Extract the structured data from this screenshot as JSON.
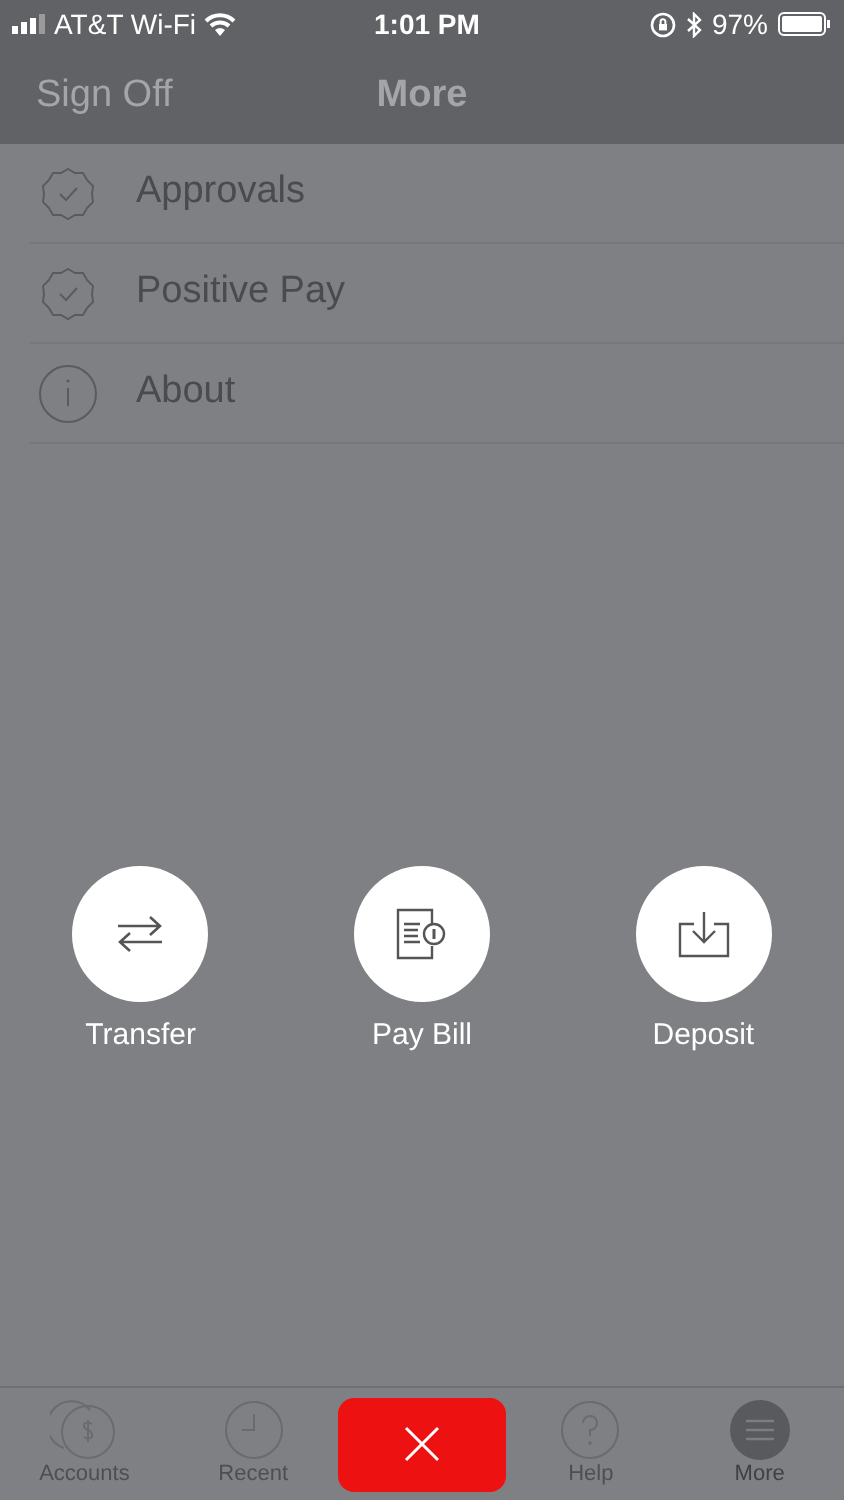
{
  "status_bar": {
    "carrier": "AT&T Wi-Fi",
    "time": "1:01 PM",
    "battery": "97%"
  },
  "nav_bar": {
    "left_button": "Sign Off",
    "title": "More"
  },
  "menu": [
    {
      "kind": "badge",
      "label": "Approvals"
    },
    {
      "kind": "badge",
      "label": "Positive Pay"
    },
    {
      "kind": "info",
      "label": "About"
    }
  ],
  "actions": [
    {
      "kind": "transfer",
      "label": "Transfer"
    },
    {
      "kind": "bill",
      "label": "Pay Bill"
    },
    {
      "kind": "deposit",
      "label": "Deposit"
    }
  ],
  "tab_bar": [
    {
      "kind": "accounts",
      "label": "Accounts",
      "selected": false
    },
    {
      "kind": "recent",
      "label": "Recent",
      "selected": false
    },
    {
      "kind": "close",
      "selected": false
    },
    {
      "kind": "help",
      "label": "Help",
      "selected": false
    },
    {
      "kind": "more",
      "label": "More",
      "selected": true
    }
  ]
}
